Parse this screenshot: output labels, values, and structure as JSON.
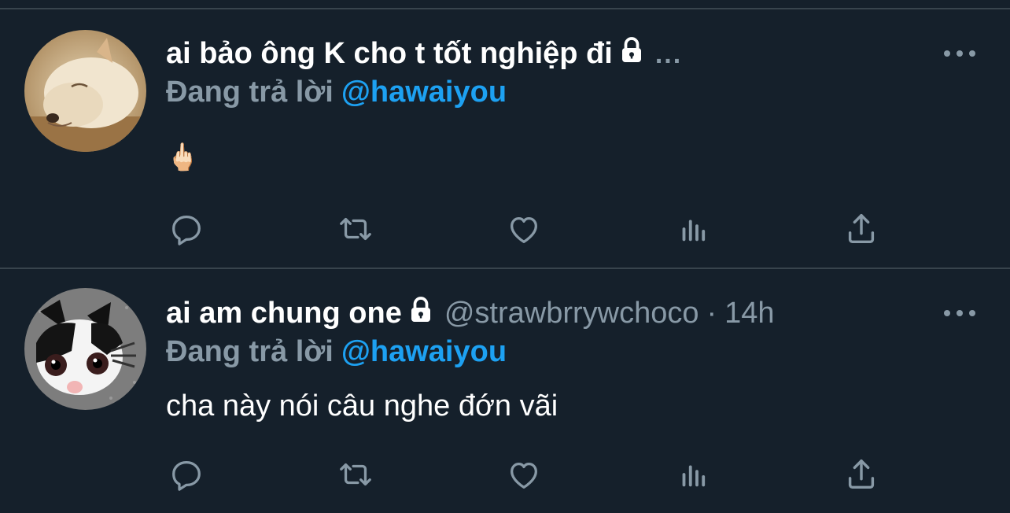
{
  "tweets": [
    {
      "display_name": "ai bảo ông K cho t tốt nghiệp đi",
      "truncated_marker": "...",
      "reply_prefix": "Đang trả lời",
      "reply_to": "@hawaiyou",
      "text": "🖕🏻"
    },
    {
      "display_name": "ai am chung one",
      "handle": "@strawbrrywchoco",
      "separator": "·",
      "time": "14h",
      "reply_prefix": "Đang trả lời",
      "reply_to": "@hawaiyou",
      "text": "cha này nói câu nghe đớn vãi"
    }
  ],
  "icons": {
    "more": "more-horizontal-icon",
    "lock": "lock-icon",
    "reply": "reply-icon",
    "retweet": "retweet-icon",
    "like": "heart-icon",
    "analytics": "analytics-icon",
    "share": "share-icon"
  },
  "colors": {
    "background": "#15202b",
    "divider": "#38444d",
    "secondary_text": "#8899a6",
    "link": "#1da1f2",
    "primary_text": "#ffffff"
  }
}
